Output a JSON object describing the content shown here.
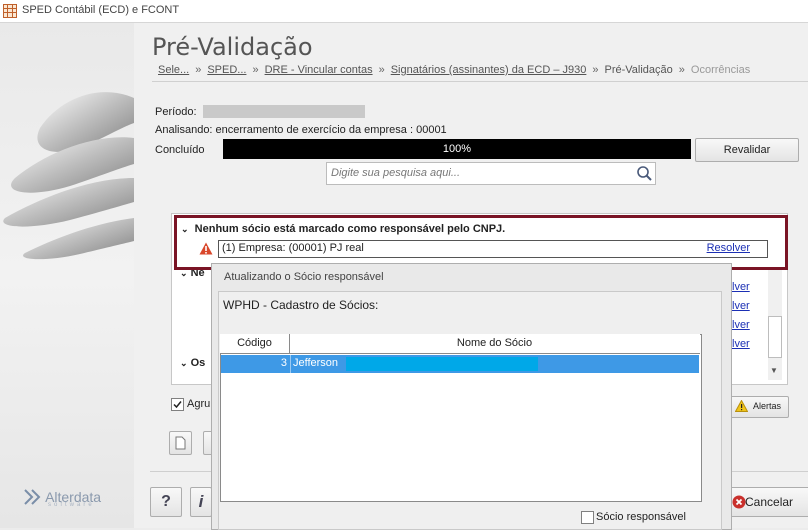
{
  "window": {
    "title": "SPED Contábil (ECD) e FCONT"
  },
  "page": {
    "heading": "Pré-Validação",
    "breadcrumb": [
      "Sele...",
      "SPED...",
      "DRE - Vincular contas",
      "Signatários (assinantes) da ECD – J930",
      "Pré-Validação",
      "Ocorrências"
    ],
    "breadcrumb_sep": "»"
  },
  "info": {
    "periodo_label": "Período:",
    "analisando": "Analisando: encerramento de exercício da empresa : 00001",
    "concluido_label": "Concluído",
    "progress_text": "100%",
    "progress_value": 100,
    "revalidar_label": "Revalidar"
  },
  "search": {
    "placeholder": "Digite sua pesquisa aqui..."
  },
  "tree": {
    "group1_title": "Nenhum sócio está marcado como responsável pelo CNPJ.",
    "group1_item": "(1) Empresa: (00001) PJ real",
    "resolver_label": "Resolver",
    "group2_partial": "Ne",
    "group3_partial": "Os",
    "side_links": [
      "lver",
      "lver",
      "lver",
      "lver"
    ]
  },
  "footer": {
    "agrupar_partial": "Agru",
    "alertas_label": "Alertas",
    "cancelar_label": "Cancelar",
    "help_glyph": "?",
    "info_glyph": "i",
    "brand": "Alterdata",
    "brand_sub": "software"
  },
  "dialog": {
    "title": "Atualizando o Sócio responsável",
    "panel_title": "WPHD - Cadastro de Sócios:",
    "columns": [
      "Código",
      "Nome do Sócio"
    ],
    "rows": [
      {
        "codigo": "3",
        "nome": "Jefferson"
      }
    ],
    "checkbox_label": "Sócio responsável"
  },
  "colors": {
    "accent_red": "#7a1425",
    "selection_blue": "#3e99e6",
    "link_blue": "#1b2fb4"
  }
}
